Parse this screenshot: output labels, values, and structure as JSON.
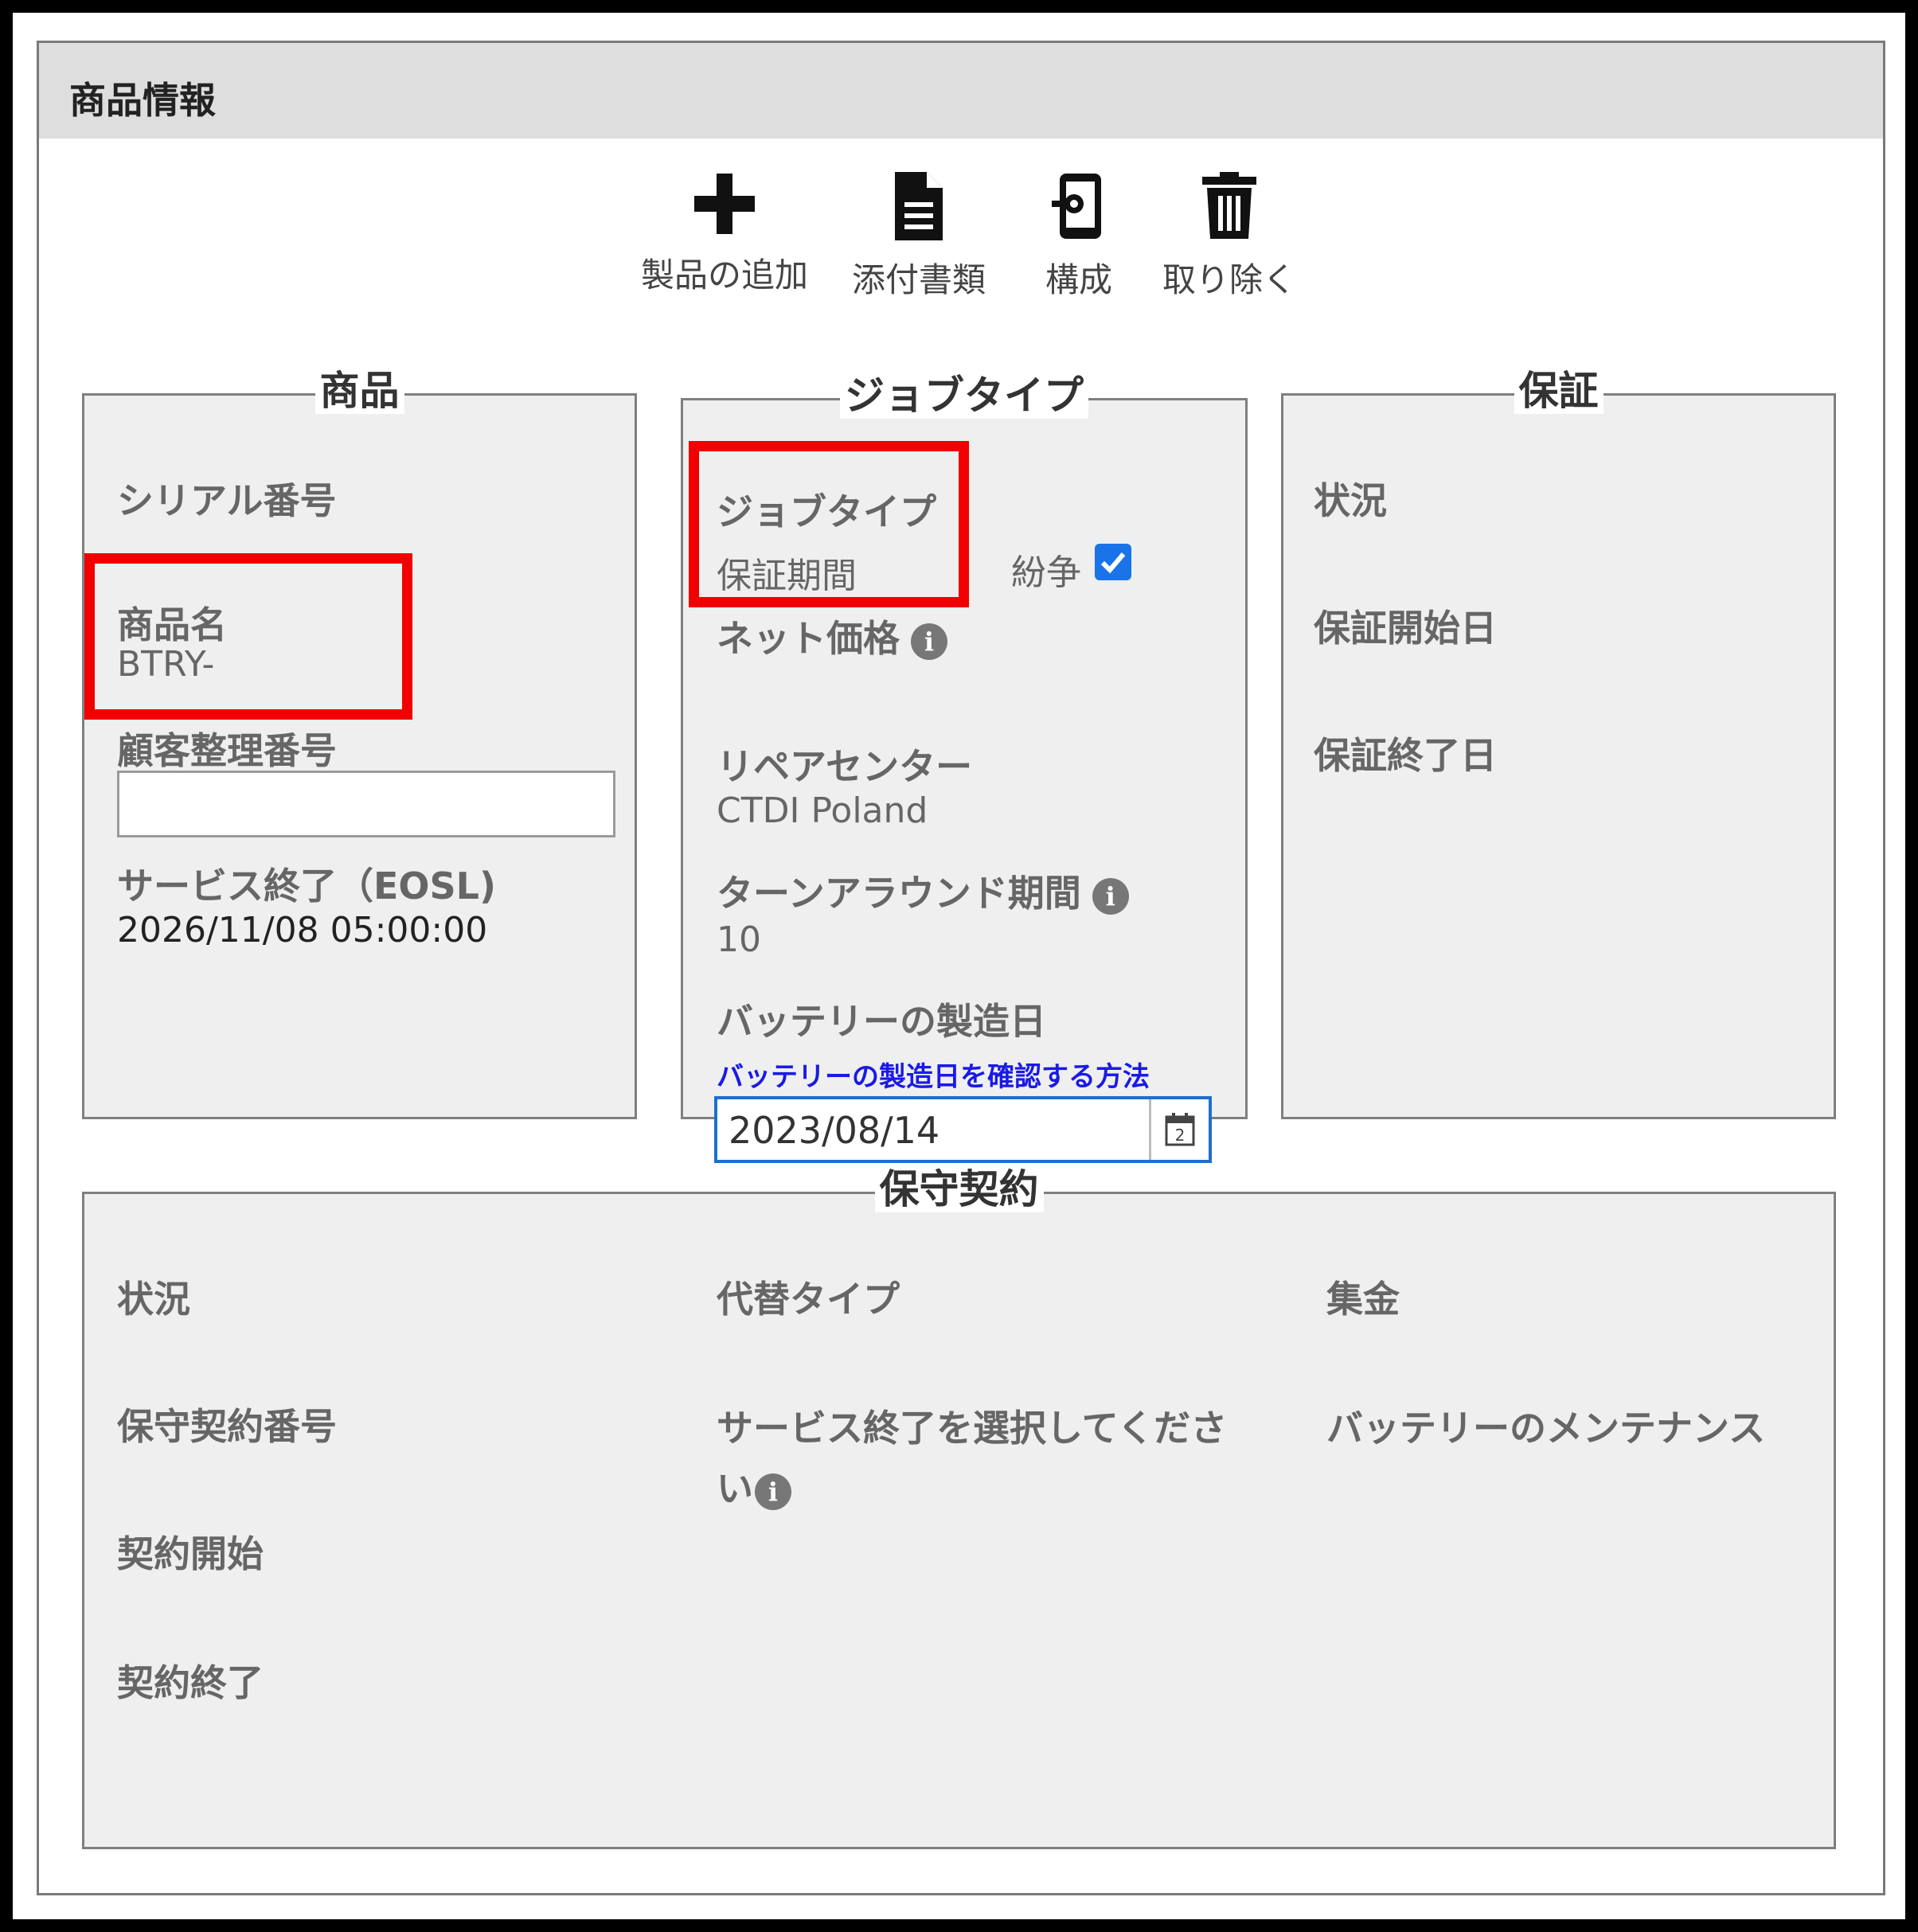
{
  "panel": {
    "title": "商品情報"
  },
  "toolbar": {
    "add_product": "製品の追加",
    "attachments": "添付書類",
    "configuration": "構成",
    "remove": "取り除く"
  },
  "product": {
    "legend": "商品",
    "serial_label": "シリアル番号",
    "name_label": "商品名",
    "name_value": "BTRY-",
    "customer_ref_label": "顧客整理番号",
    "customer_ref_value": "",
    "eosl_label": "サービス終了（EOSL)",
    "eosl_value": "2026/11/08 05:00:00"
  },
  "job_type": {
    "legend": "ジョブタイプ",
    "job_type_label": "ジョブタイプ",
    "job_type_value": "保証期間",
    "dispute_label": "紛争",
    "dispute_checked": true,
    "net_price_label": "ネット価格",
    "repair_center_label": "リペアセンター",
    "repair_center_value": "CTDI Poland",
    "turnaround_label": "ターンアラウンド期間",
    "turnaround_value": "10",
    "battery_date_label": "バッテリーの製造日",
    "battery_date_link": "バッテリーの製造日を確認する方法",
    "battery_date_value": "2023/08/14"
  },
  "warranty": {
    "legend": "保証",
    "status_label": "状況",
    "start_label": "保証開始日",
    "end_label": "保証終了日"
  },
  "maintenance": {
    "legend": "保守契約",
    "status_label": "状況",
    "contract_no_label": "保守契約番号",
    "start_label": "契約開始",
    "end_label": "契約終了",
    "alt_type_label": "代替タイプ",
    "eos_select_label_line1": "サービス終了を選択してくださ",
    "eos_select_label_line2": "い",
    "collection_label": "集金",
    "battery_maintenance_label": "バッテリーのメンテナンス"
  },
  "colors": {
    "highlight": "#f20000",
    "link": "#1a1ae6",
    "focus": "#1d6fd1",
    "checkbox": "#1a73e8"
  },
  "icons": [
    "plus-icon",
    "document-icon",
    "config-icon",
    "trash-icon",
    "info-icon",
    "calendar-icon",
    "check-icon"
  ]
}
